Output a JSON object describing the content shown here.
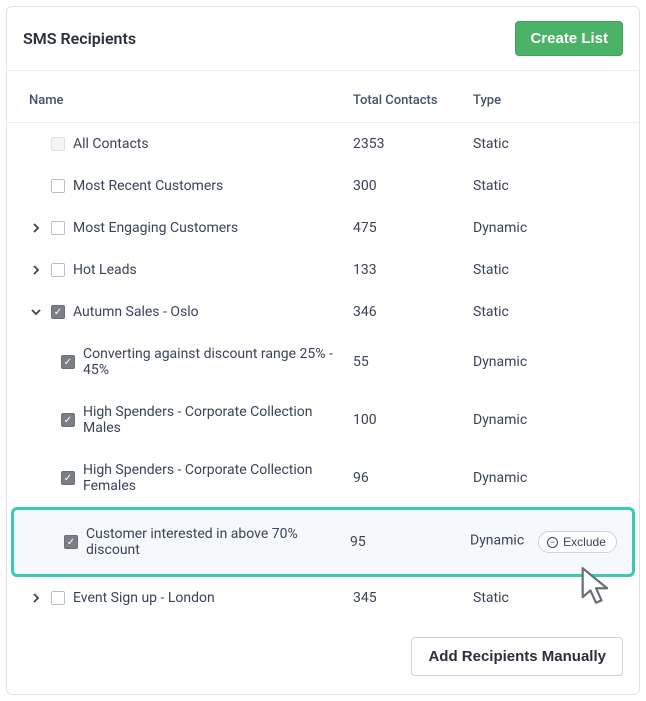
{
  "header": {
    "title": "SMS Recipients",
    "create_label": "Create List"
  },
  "columns": {
    "name": "Name",
    "total": "Total Contacts",
    "type": "Type"
  },
  "rows": [
    {
      "indent": 0,
      "expander": "none",
      "checkbox": "disabled",
      "name": "All Contacts",
      "total": "2353",
      "type": "Static"
    },
    {
      "indent": 0,
      "expander": "none",
      "checkbox": "unchecked",
      "name": "Most Recent Customers",
      "total": "300",
      "type": "Static"
    },
    {
      "indent": 0,
      "expander": "closed",
      "checkbox": "unchecked",
      "name": "Most Engaging Customers",
      "total": "475",
      "type": "Dynamic"
    },
    {
      "indent": 0,
      "expander": "closed",
      "checkbox": "unchecked",
      "name": "Hot Leads",
      "total": "133",
      "type": "Static"
    },
    {
      "indent": 0,
      "expander": "open",
      "checkbox": "checked",
      "name": "Autumn Sales - Oslo",
      "total": "346",
      "type": "Static"
    },
    {
      "indent": 1,
      "expander": "none",
      "checkbox": "checked",
      "name": "Converting against discount range 25% - 45%",
      "total": "55",
      "type": "Dynamic"
    },
    {
      "indent": 1,
      "expander": "none",
      "checkbox": "checked",
      "name": "High Spenders - Corporate Collection Males",
      "total": "100",
      "type": "Dynamic"
    },
    {
      "indent": 1,
      "expander": "none",
      "checkbox": "checked",
      "name": "High Spenders - Corporate Collection Females",
      "total": "96",
      "type": "Dynamic"
    },
    {
      "indent": 1,
      "expander": "none",
      "checkbox": "checked",
      "name": "Customer interested in above 70% discount",
      "total": "95",
      "type": "Dynamic",
      "highlighted": true,
      "exclude": true
    },
    {
      "indent": 0,
      "expander": "closed",
      "checkbox": "unchecked",
      "name": "Event Sign up - London",
      "total": "345",
      "type": "Static"
    }
  ],
  "actions": {
    "exclude_label": "Exclude",
    "add_manually_label": "Add Recipients Manually"
  }
}
